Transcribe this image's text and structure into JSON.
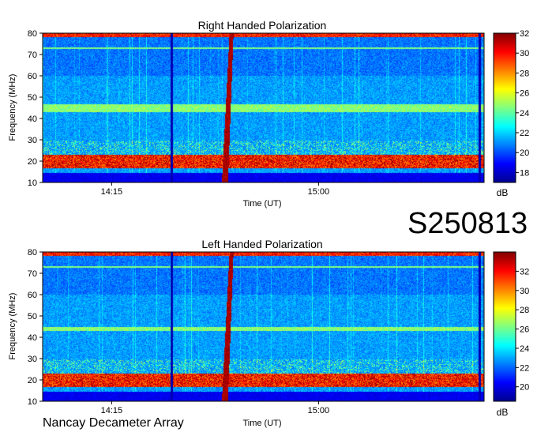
{
  "observation_id": "S250813",
  "instrument_name": "Nancay Decameter Array",
  "chart_data": [
    {
      "type": "heatmap",
      "title": "Right Handed Polarization",
      "xlabel": "Time (UT)",
      "ylabel": "Frequency (MHz)",
      "x_ticks": [
        "14:15",
        "15:00"
      ],
      "y_ticks": [
        10,
        20,
        30,
        40,
        50,
        60,
        70,
        80
      ],
      "ylim": [
        10,
        80
      ],
      "colorbar": {
        "label": "dB",
        "ticks": [
          18,
          20,
          22,
          24,
          26,
          28,
          30,
          32
        ],
        "range": [
          17,
          32
        ]
      },
      "features": {
        "bright_band_mhz": [
          43,
          47
        ],
        "intense_low_band_mhz": [
          17,
          23
        ],
        "type_iii_burst_time": "14:41",
        "vertical_lines_times": [
          "14:28",
          "15:35"
        ]
      }
    },
    {
      "type": "heatmap",
      "title": "Left Handed Polarization",
      "xlabel": "Time (UT)",
      "ylabel": "Frequency (MHz)",
      "x_ticks": [
        "14:15",
        "15:00"
      ],
      "y_ticks": [
        10,
        20,
        30,
        40,
        50,
        60,
        70,
        80
      ],
      "ylim": [
        10,
        80
      ],
      "colorbar": {
        "label": "dB",
        "ticks": [
          20,
          22,
          24,
          26,
          28,
          30,
          32
        ],
        "range": [
          18.5,
          34
        ]
      },
      "features": {
        "bright_band_mhz": [
          43,
          45
        ],
        "intense_low_band_mhz": [
          17,
          23
        ],
        "type_iii_burst_time": "14:41",
        "vertical_lines_times": [
          "14:28",
          "15:35"
        ]
      }
    }
  ]
}
